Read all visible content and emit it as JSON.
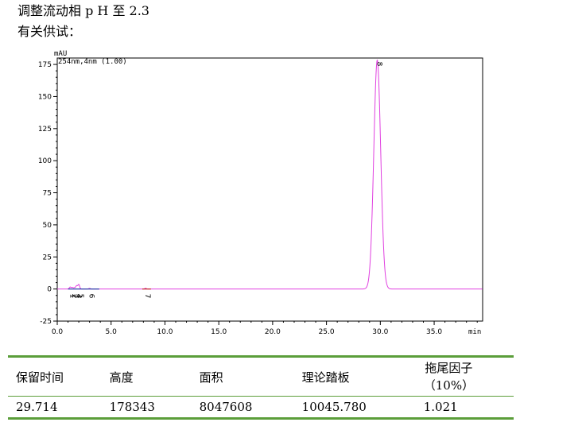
{
  "header": {
    "line1": "调整流动相 p H 至 2.3",
    "line2": "有关供试："
  },
  "chart_data": {
    "type": "line",
    "y_unit": "mAU",
    "x_unit": "min",
    "trace_label": "254nm,4nm (1.00)",
    "xlim": [
      0,
      39.5
    ],
    "ylim": [
      -25,
      180
    ],
    "x_ticks": [
      0,
      5,
      10,
      15,
      20,
      25,
      30,
      35
    ],
    "x_tick_labels": [
      "0.0",
      "5.0",
      "10.0",
      "15.0",
      "20.0",
      "25.0",
      "30.0",
      "35.0"
    ],
    "y_ticks": [
      -25,
      0,
      25,
      50,
      75,
      100,
      125,
      150,
      175
    ],
    "y_tick_labels": [
      "-25",
      "0",
      "25",
      "50",
      "75",
      "100",
      "125",
      "150",
      "175"
    ],
    "peaks": [
      {
        "label": "1",
        "rt": 1.2,
        "height": 1.5
      },
      {
        "label": "2",
        "rt": 1.4,
        "height": 1.2
      },
      {
        "label": "3",
        "rt": 1.6,
        "height": 1.0
      },
      {
        "label": "4",
        "rt": 1.8,
        "height": 2.5
      },
      {
        "label": "5",
        "rt": 2.0,
        "height": 3.5
      },
      {
        "label": "6",
        "rt": 3.0,
        "height": 0.5
      },
      {
        "label": "7",
        "rt": 8.2,
        "height": 0.6
      },
      {
        "label": "8",
        "rt": 29.714,
        "height": 178.343
      }
    ],
    "colors": {
      "trace": "#e040e0",
      "trace_label": "#c030c0",
      "baseline_segment_1": "#2a3aa8",
      "baseline_segment_2": "#c02020"
    }
  },
  "table": {
    "headers": [
      "保留时间",
      "高度",
      "面积",
      "理论踏板",
      "拖尾因子"
    ],
    "header_sub": "（10%）",
    "row": [
      "29.714",
      "178343",
      "8047608",
      "10045.780",
      "1.021"
    ],
    "border_color": "#5b9e3a"
  }
}
